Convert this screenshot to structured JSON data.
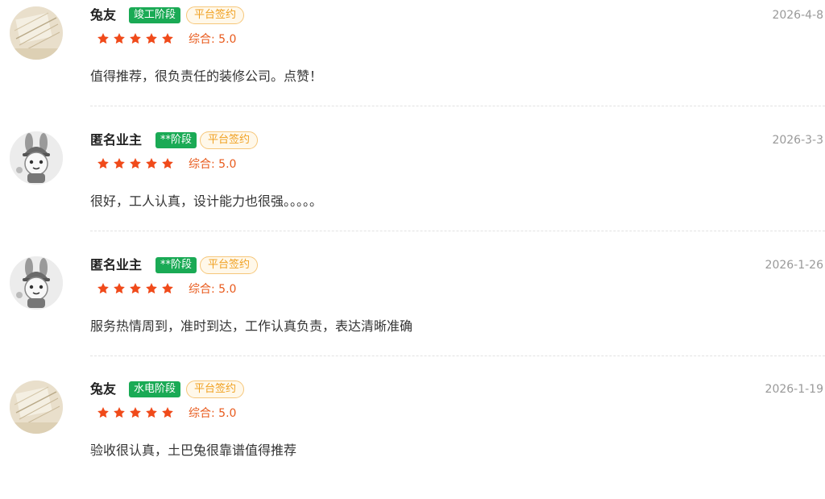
{
  "reviews": [
    {
      "avatar_icon": "sketch-avatar-icon",
      "name": "兔友",
      "stage": "竣工阶段",
      "platform_tag": "平台签约",
      "rating": 5,
      "score_label": "综合: 5.0",
      "date": "2026-4-8",
      "content": "值得推荐，很负责任的装修公司。点赞！"
    },
    {
      "avatar_icon": "rabbit-mascot-icon",
      "name": "匿名业主",
      "stage": "**阶段",
      "platform_tag": "平台签约",
      "rating": 5,
      "score_label": "综合: 5.0",
      "date": "2026-3-3",
      "content": "很好，工人认真，设计能力也很强。。。。。"
    },
    {
      "avatar_icon": "rabbit-mascot-icon",
      "name": "匿名业主",
      "stage": "**阶段",
      "platform_tag": "平台签约",
      "rating": 5,
      "score_label": "综合: 5.0",
      "date": "2026-1-26",
      "content": "服务热情周到，准时到达，工作认真负责，表达清晰准确"
    },
    {
      "avatar_icon": "sketch-avatar-icon",
      "name": "兔友",
      "stage": "水电阶段",
      "platform_tag": "平台签约",
      "rating": 5,
      "score_label": "综合: 5.0",
      "date": "2026-1-19",
      "content": "验收很认真，土巴兔很靠谱值得推荐"
    }
  ],
  "colors": {
    "stage_green": "#1aaa55",
    "platform_orange": "#f0a020",
    "star_red": "#f04a1a",
    "score_orange": "#e85a1c"
  }
}
